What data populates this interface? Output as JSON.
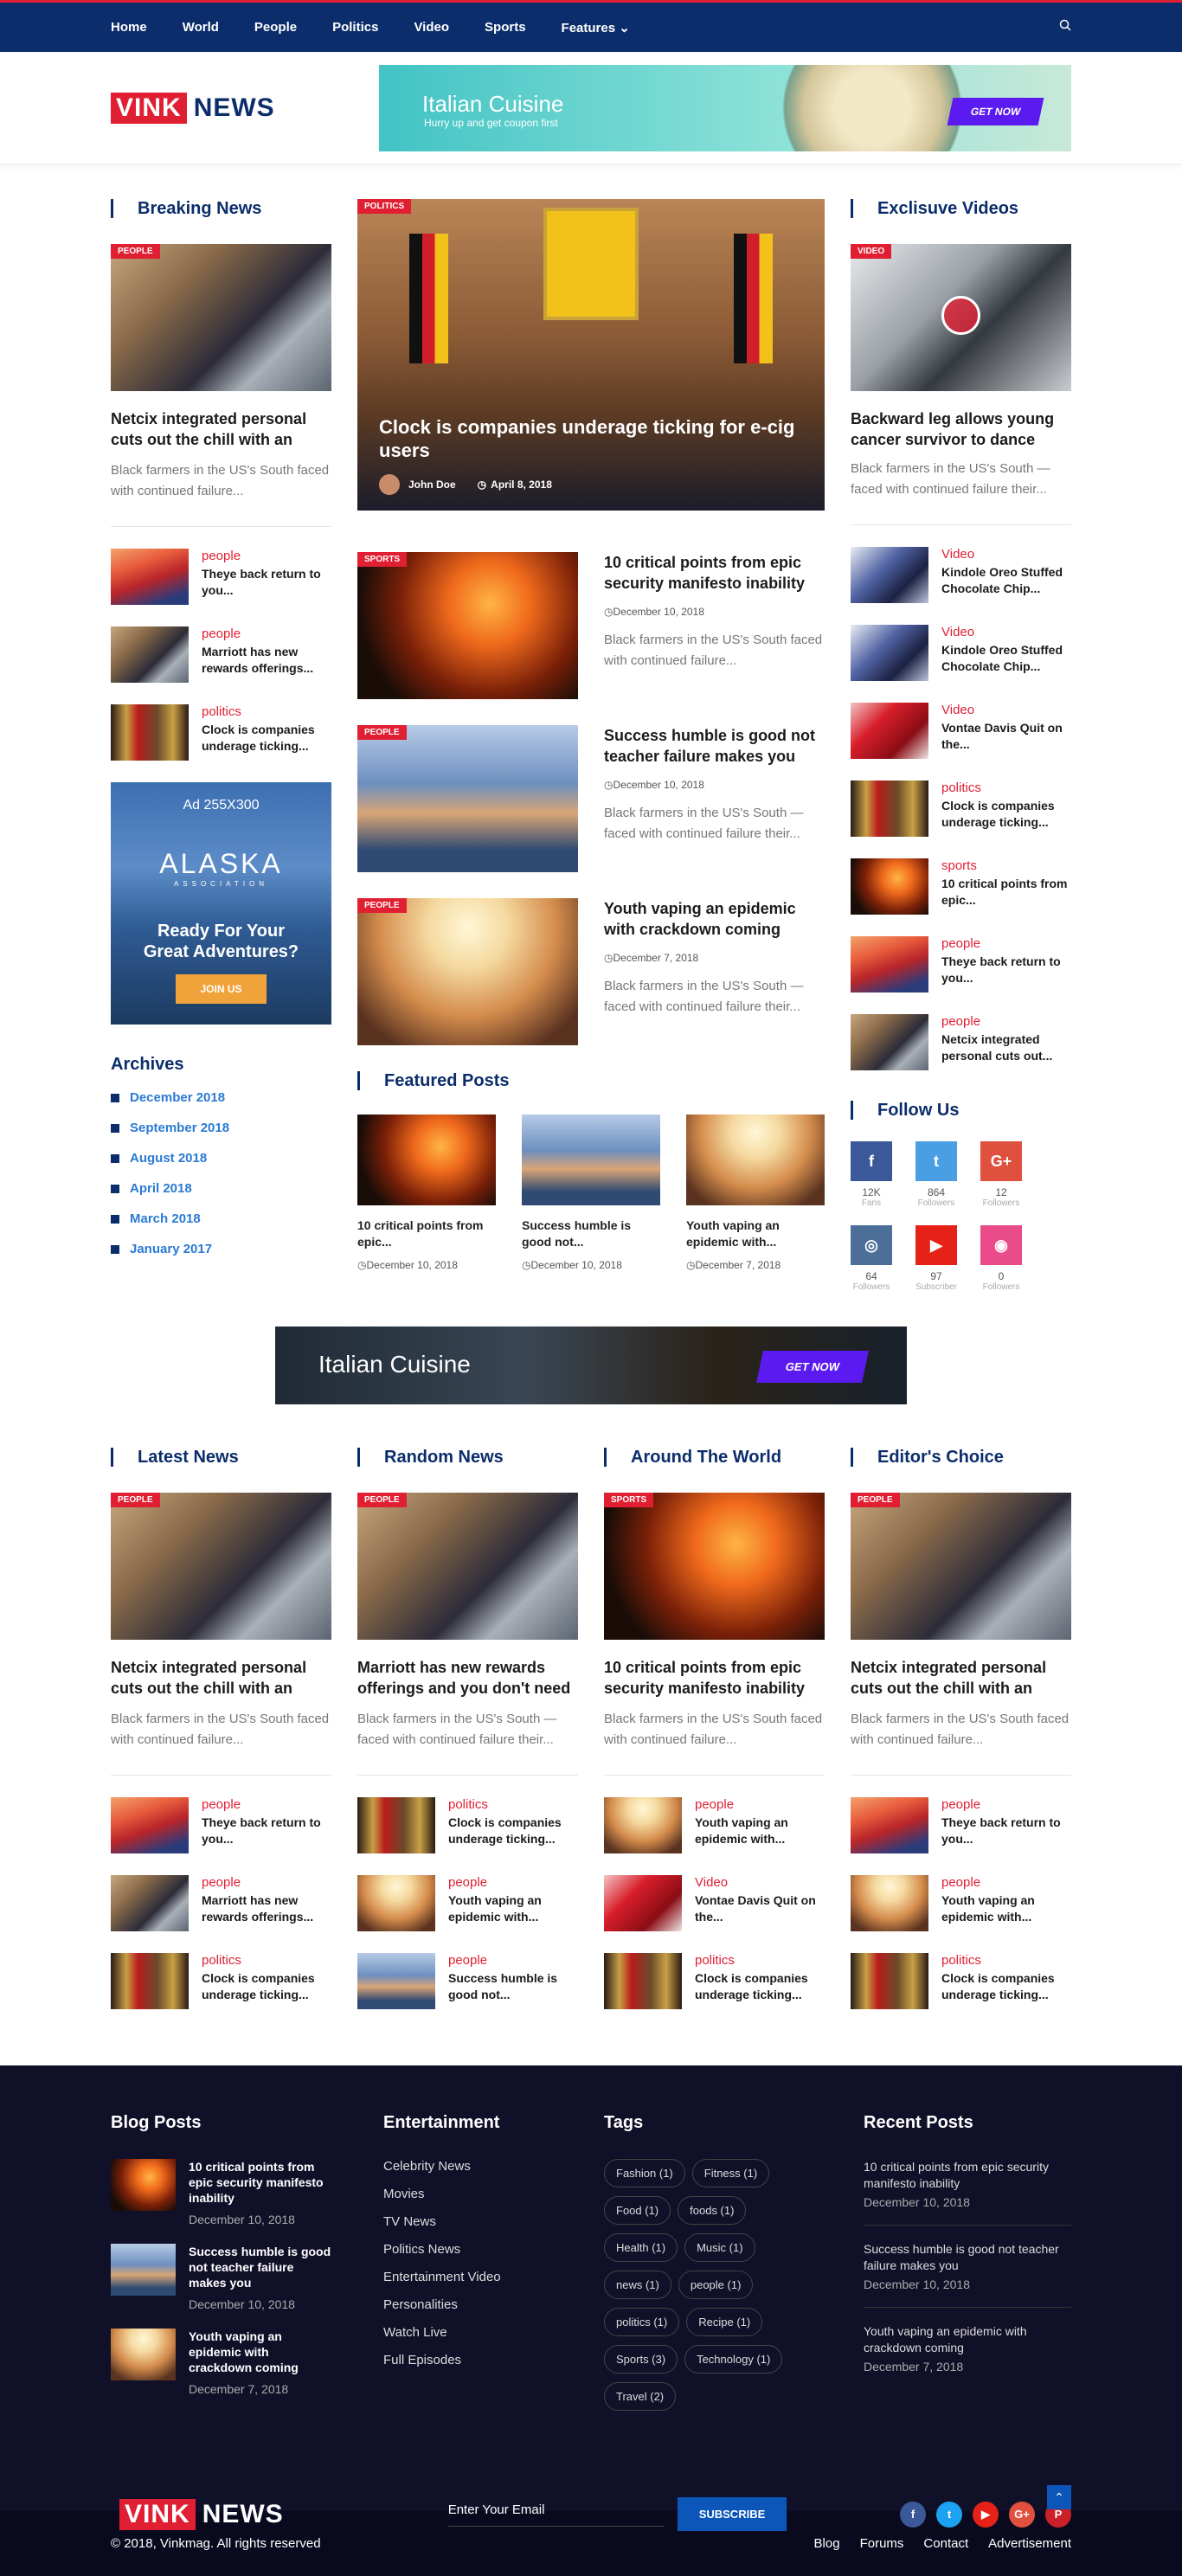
{
  "nav": {
    "items": [
      "Home",
      "World",
      "People",
      "Politics",
      "Video",
      "Sports",
      "Features"
    ],
    "features_chevron": "⌄",
    "search_icon": "search-icon"
  },
  "logo": {
    "vink": "VINK",
    "news": "NEWS"
  },
  "header_ad": {
    "title": "Italian Cuisine",
    "subtitle": "Hurry up  and get coupon first",
    "button": "GET NOW"
  },
  "breaking": {
    "title": "Breaking News",
    "lead": {
      "badge": "PEOPLE",
      "title": "Netcix integrated personal cuts out the chill with an",
      "excerpt": "Black farmers in the US's South faced with continued failure..."
    },
    "items": [
      {
        "cat": "people",
        "title": "Theye back return to you..."
      },
      {
        "cat": "people",
        "title": "Marriott has new rewards offerings..."
      },
      {
        "cat": "politics",
        "title": "Clock is companies underage ticking..."
      }
    ]
  },
  "alaska_ad": {
    "size": "Ad 255X300",
    "name": "ALASKA",
    "sub": "ASSOCIATION",
    "line1": "Ready For Your",
    "line2": "Great Adventures?",
    "button": "JOIN US"
  },
  "archives": {
    "title": "Archives",
    "items": [
      "December 2018",
      "September 2018",
      "August 2018",
      "April 2018",
      "March 2018",
      "January 2017"
    ]
  },
  "hero": {
    "badge": "POLITICS",
    "title": "Clock is companies underage ticking for e-cig users",
    "author": "John Doe",
    "date": "April 8, 2018"
  },
  "center_list": [
    {
      "badge": "SPORTS",
      "title": "10 critical points from epic security manifesto inability",
      "date": "December 10, 2018",
      "excerpt": "Black farmers in the US's South faced with continued failure..."
    },
    {
      "badge": "PEOPLE",
      "title": "Success humble is good not teacher failure makes you",
      "date": "December 10, 2018",
      "excerpt": "Black farmers in the US's South — faced with continued failure their..."
    },
    {
      "badge": "PEOPLE",
      "title": "Youth vaping an epidemic with crackdown coming",
      "date": "December 7, 2018",
      "excerpt": "Black farmers in the US's South — faced with continued failure their..."
    }
  ],
  "featured": {
    "title": "Featured Posts",
    "items": [
      {
        "title": "10 critical points from epic...",
        "date": "December 10, 2018"
      },
      {
        "title": "Success humble is good not...",
        "date": "December 10, 2018"
      },
      {
        "title": "Youth vaping an epidemic with...",
        "date": "December 7, 2018"
      }
    ]
  },
  "videos": {
    "title": "Exclisuve Videos",
    "lead": {
      "badge": "VIDEO",
      "title": "Backward leg allows young cancer survivor to dance",
      "excerpt": "Black farmers in the US's South — faced with continued failure their..."
    },
    "items": [
      {
        "cat": "Video",
        "title": "Kindole Oreo Stuffed Chocolate Chip..."
      },
      {
        "cat": "Video",
        "title": "Kindole Oreo Stuffed Chocolate Chip..."
      },
      {
        "cat": "Video",
        "title": "Vontae Davis Quit on the..."
      },
      {
        "cat": "politics",
        "title": "Clock is companies underage ticking..."
      },
      {
        "cat": "sports",
        "title": "10 critical points from epic..."
      },
      {
        "cat": "people",
        "title": "Theye back return to you..."
      },
      {
        "cat": "people",
        "title": "Netcix integrated personal cuts out..."
      }
    ]
  },
  "follow": {
    "title": "Follow Us",
    "items": [
      {
        "icon": "f",
        "count": "12K",
        "label": "Fans",
        "color": "#3b5998"
      },
      {
        "icon": "t",
        "count": "864",
        "label": "Followers",
        "color": "#4a9fe4"
      },
      {
        "icon": "G+",
        "count": "12",
        "label": "Followers",
        "color": "#e0503f"
      },
      {
        "icon": "",
        "count": "",
        "label": "",
        "color": ""
      },
      {
        "icon": "◎",
        "count": "64",
        "label": "Followers",
        "color": "#4b6f98"
      },
      {
        "icon": "▶",
        "count": "97",
        "label": "Subscriber",
        "color": "#e62117"
      },
      {
        "icon": "◉",
        "count": "0",
        "label": "Followers",
        "color": "#ea4c89"
      }
    ]
  },
  "mid_ad": {
    "title": "Italian Cuisine",
    "button": "GET NOW"
  },
  "bottom_cols": [
    {
      "title": "Latest News",
      "lead": {
        "badge": "PEOPLE",
        "title": "Netcix integrated personal cuts out the chill with an",
        "excerpt": "Black farmers in the US's South faced with continued failure..."
      },
      "items": [
        {
          "cat": "people",
          "title": "Theye back return to you..."
        },
        {
          "cat": "people",
          "title": "Marriott has new rewards offerings..."
        },
        {
          "cat": "politics",
          "title": "Clock is companies underage ticking..."
        }
      ]
    },
    {
      "title": "Random News",
      "lead": {
        "badge": "PEOPLE",
        "title": "Marriott has new rewards offerings and you don't need",
        "excerpt": "Black farmers in the US's South — faced with continued failure their..."
      },
      "items": [
        {
          "cat": "politics",
          "title": "Clock is companies underage ticking..."
        },
        {
          "cat": "people",
          "title": "Youth vaping an epidemic with..."
        },
        {
          "cat": "people",
          "title": "Success humble is good not..."
        }
      ]
    },
    {
      "title": "Around The World",
      "lead": {
        "badge": "SPORTS",
        "title": "10 critical points from epic security manifesto inability",
        "excerpt": "Black farmers in the US's South faced with continued failure..."
      },
      "items": [
        {
          "cat": "people",
          "title": "Youth vaping an epidemic with..."
        },
        {
          "cat": "Video",
          "title": "Vontae Davis Quit on the..."
        },
        {
          "cat": "politics",
          "title": "Clock is companies underage ticking..."
        }
      ]
    },
    {
      "title": "Editor's Choice",
      "lead": {
        "badge": "PEOPLE",
        "title": "Netcix integrated personal cuts out the chill with an",
        "excerpt": "Black farmers in the US's South faced with continued failure..."
      },
      "items": [
        {
          "cat": "people",
          "title": "Theye back return to you..."
        },
        {
          "cat": "people",
          "title": "Youth vaping an epidemic with..."
        },
        {
          "cat": "politics",
          "title": "Clock is companies underage ticking..."
        }
      ]
    }
  ],
  "footer": {
    "blog": {
      "title": "Blog Posts",
      "items": [
        {
          "title": "10 critical points from epic security manifesto inability",
          "date": "December 10, 2018"
        },
        {
          "title": "Success humble is good not teacher failure makes you",
          "date": "December 10, 2018"
        },
        {
          "title": "Youth vaping an epidemic with crackdown coming",
          "date": "December 7, 2018"
        }
      ]
    },
    "ent": {
      "title": "Entertainment",
      "items": [
        "Celebrity News",
        "Movies",
        "TV News",
        "Politics News",
        "Entertainment Video",
        "Personalities",
        "Watch Live",
        "Full Episodes"
      ]
    },
    "tags": {
      "title": "Tags",
      "items": [
        "Fashion (1)",
        "Fitness (1)",
        "Food (1)",
        "foods (1)",
        "Health (1)",
        "Music (1)",
        "news (1)",
        "people (1)",
        "politics (1)",
        "Recipe (1)",
        "Sports (3)",
        "Technology (1)",
        "Travel (2)"
      ]
    },
    "recent": {
      "title": "Recent Posts",
      "items": [
        {
          "title": "10 critical points from epic security manifesto inability",
          "date": "December 10, 2018"
        },
        {
          "title": "Success humble is good not teacher failure makes you",
          "date": "December 10, 2018"
        },
        {
          "title": "Youth vaping an epidemic with crackdown coming",
          "date": "December 7, 2018"
        }
      ]
    },
    "email_placeholder": "Enter Your Email",
    "subscribe": "SUBSCRIBE",
    "socials": [
      {
        "icon": "f",
        "color": "#3b5998"
      },
      {
        "icon": "t",
        "color": "#1da1f2"
      },
      {
        "icon": "▶",
        "color": "#e62117"
      },
      {
        "icon": "G+",
        "color": "#e0503f"
      },
      {
        "icon": "P",
        "color": "#cb2027"
      }
    ],
    "copyright": "© 2018, Vinkmag. All rights reserved",
    "links": [
      "Blog",
      "Forums",
      "Contact",
      "Advertisement"
    ],
    "to_top": "⌃"
  }
}
